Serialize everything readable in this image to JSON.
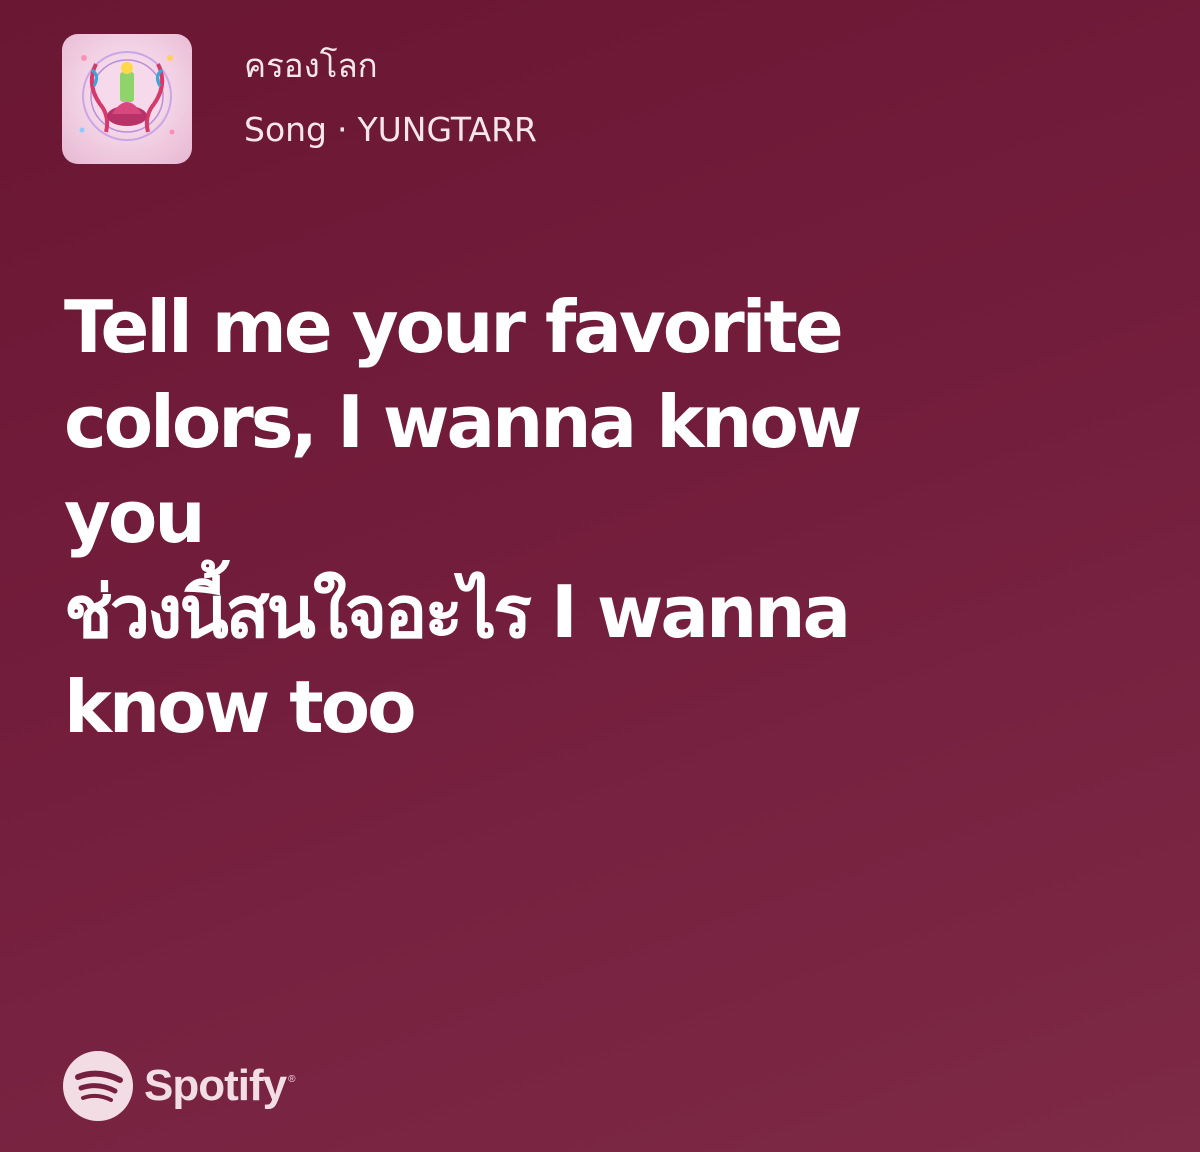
{
  "song": {
    "title": "ครองโลก",
    "type_label": "Song",
    "separator": "·",
    "artist": "YUNGTARR",
    "cover_icon": "album-cover-art"
  },
  "lyrics": {
    "lines": [
      "Tell me your favorite",
      "colors, I wanna know",
      "you",
      "ช่วงนี้สนใจอะไร I wanna",
      "know too"
    ]
  },
  "brand": {
    "name": "Spotify",
    "registered": "®",
    "icon": "spotify-logo-icon"
  },
  "colors": {
    "background_top": "#6a1733",
    "background_bottom": "#7d2a46",
    "text": "#ffffff",
    "secondary_text": "#f6e6ec"
  }
}
